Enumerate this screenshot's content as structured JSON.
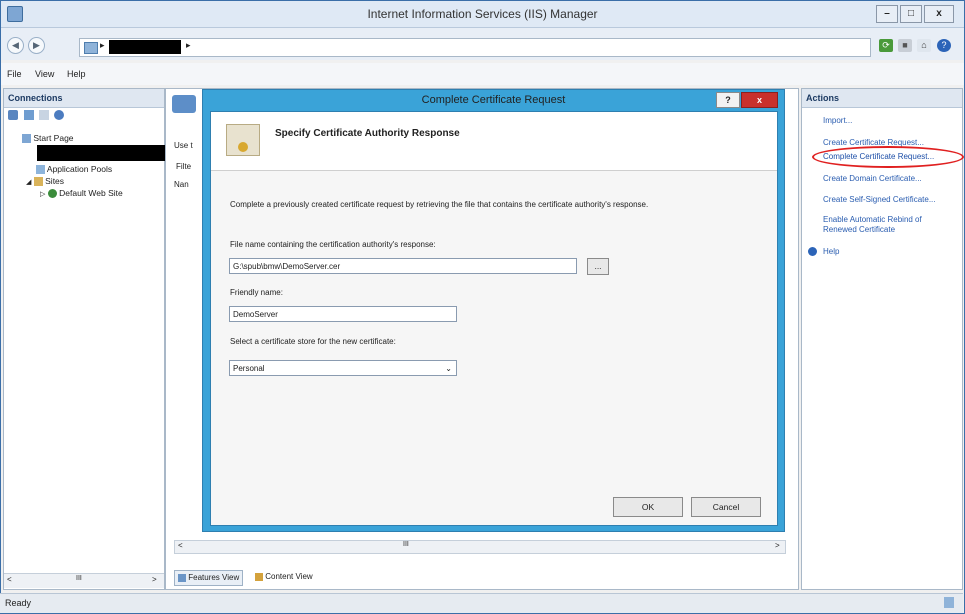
{
  "window": {
    "title": "Internet Information Services (IIS) Manager",
    "controls": {
      "minimize": "–",
      "maximize": "□",
      "close": "x"
    }
  },
  "address": {
    "separator": "▸",
    "back": "◀",
    "forward": "▶"
  },
  "menu": [
    "File",
    "View",
    "Help"
  ],
  "connections": {
    "header": "Connections",
    "tree": [
      {
        "label": "Start Page"
      },
      {
        "label": "Application Pools"
      },
      {
        "label": "Sites"
      },
      {
        "label": "Default Web Site"
      }
    ]
  },
  "center": {
    "fragments": [
      "Use t",
      "Filte",
      "Nan"
    ],
    "bottom_tabs": [
      "Features View",
      "Content View"
    ],
    "scroll_left": "<",
    "scroll_right": ">",
    "scroll_grip": "III"
  },
  "dialog": {
    "title": "Complete Certificate Request",
    "help_button": "?",
    "close_button": "x",
    "heading": "Specify Certificate Authority Response",
    "description": "Complete a previously created certificate request by retrieving the file that contains the certificate authority's response.",
    "file_label": "File name containing the certification authority's response:",
    "file_value": "G:\\spub\\bmw\\DemoServer.cer",
    "browse_label": "...",
    "friendly_label": "Friendly name:",
    "friendly_value": "DemoServer",
    "store_label": "Select a certificate store for the new certificate:",
    "store_value": "Personal",
    "ok_label": "OK",
    "cancel_label": "Cancel"
  },
  "actions": {
    "header": "Actions",
    "items": [
      "Import...",
      "Create Certificate Request...",
      "Complete Certificate Request...",
      "Create Domain Certificate...",
      "Create Self-Signed Certificate...",
      "Enable Automatic Rebind of Renewed Certificate",
      "Help"
    ],
    "highlight_color": "#e02020"
  },
  "left_scroll": {
    "left": "<",
    "grip": "III",
    "right": ">"
  },
  "status": {
    "text": "Ready"
  }
}
